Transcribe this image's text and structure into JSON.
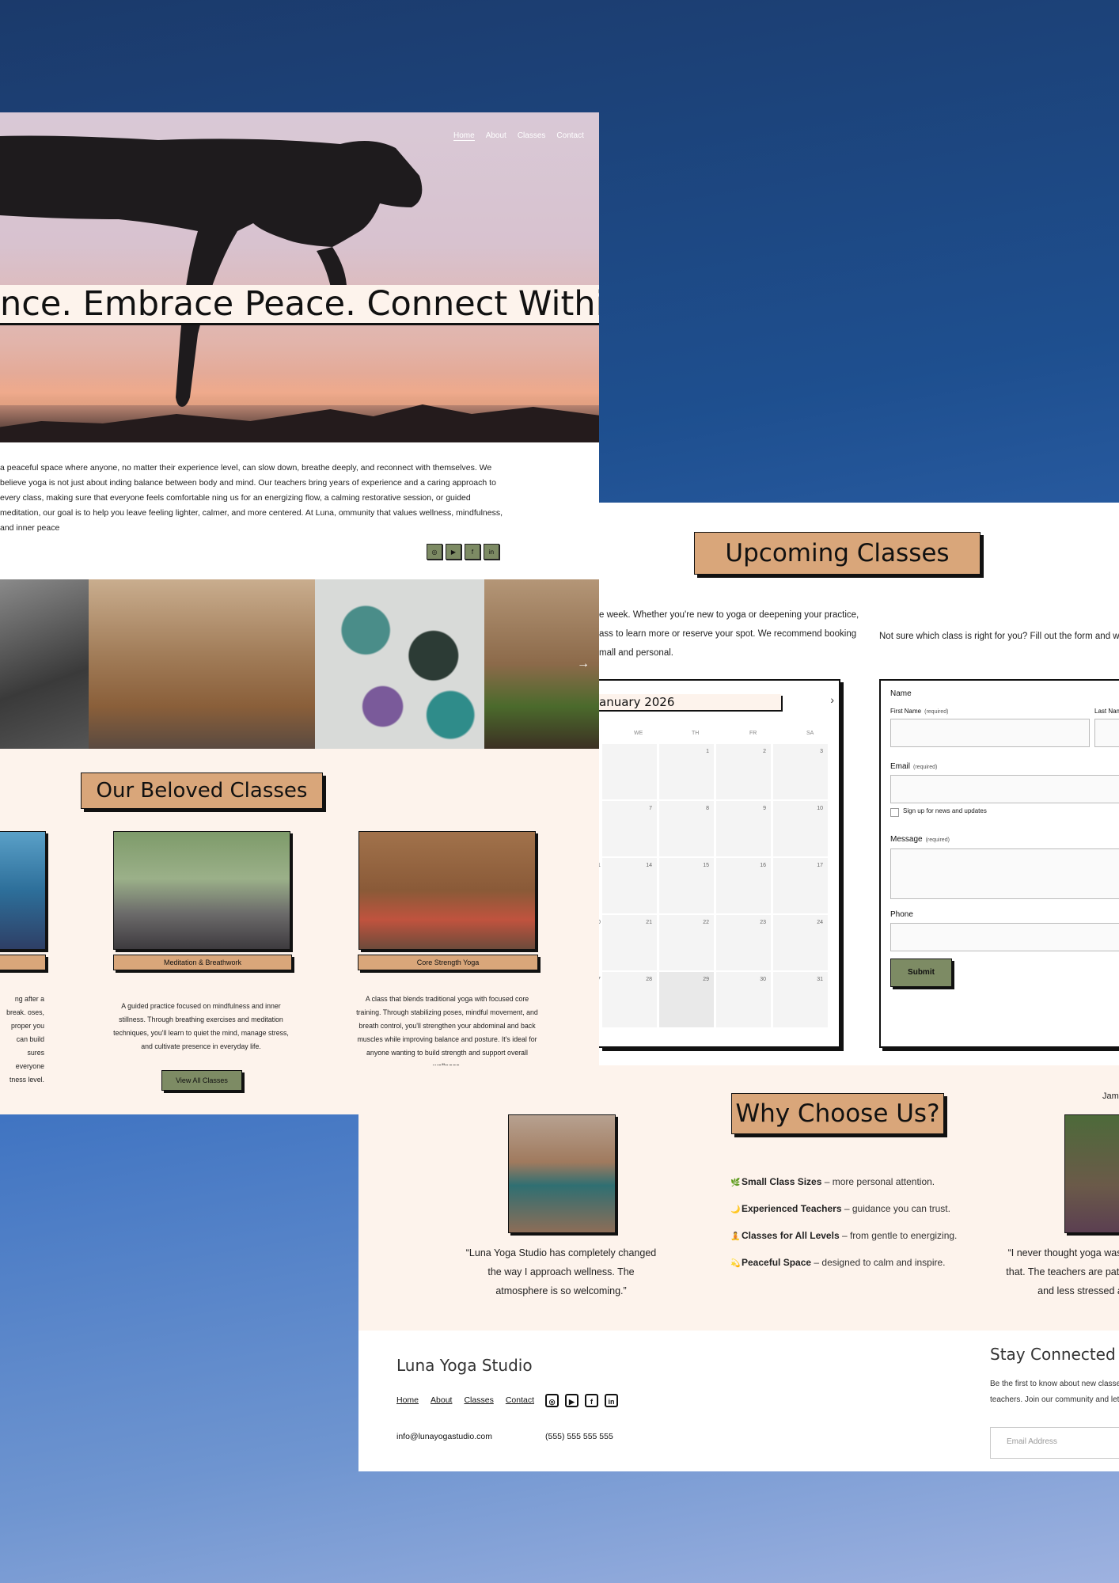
{
  "hero": {
    "nav": [
      "Home",
      "About",
      "Classes",
      "Contact"
    ],
    "title": "nce. Embrace Peace. Connect Within.",
    "intro": "a peaceful space where anyone, no matter their experience level, can slow down, breathe deeply, and reconnect with themselves. We believe yoga is not just about inding balance between body and mind. Our teachers bring years of experience and a caring approach to every class, making sure that everyone feels comfortable ning us for an energizing flow, a calming restorative session, or guided meditation, our goal is to help you leave feeling lighter, calmer, and more centered. At Luna, ommunity that values wellness, mindfulness, and inner peace",
    "social": [
      "instagram-icon",
      "youtube-icon",
      "facebook-icon",
      "linkedin-icon"
    ],
    "social_glyphs": [
      "◎",
      "▶",
      "f",
      "in"
    ],
    "gallery_arrow": "→"
  },
  "classes": {
    "title": "Our Beloved Classes",
    "items": [
      {
        "name": "",
        "desc": "ng after a break. oses, proper you can build sures everyone tness level."
      },
      {
        "name": "Meditation & Breathwork",
        "desc": "A guided practice focused on mindfulness and inner stillness. Through breathing exercises and meditation techniques, you'll learn to quiet the mind, manage stress, and cultivate presence in everyday life."
      },
      {
        "name": "Core Strength Yoga",
        "desc": "A class that blends traditional yoga with focused core training. Through stabilizing poses, mindful movement, and breath control, you'll strengthen your abdominal and back muscles while improving balance and posture. It's ideal for anyone wanting to build strength and support overall wellness."
      }
    ],
    "view_all": "View All Classes"
  },
  "upcoming": {
    "title": "Upcoming Classes",
    "text_lines": [
      "e week. Whether you're new to yoga or deepening your practice,",
      "ass to learn more or reserve your spot. We recommend booking",
      "mall and personal."
    ],
    "form_intro": "Not sure which class is right for you? Fill out the form and we'll h",
    "calendar": {
      "month": "anuary 2026",
      "next": "›",
      "weekdays": [
        "WE",
        "TH",
        "FR",
        "SA"
      ],
      "rows": [
        [
          "",
          "1",
          "2",
          "3"
        ],
        [
          "",
          "7",
          "8",
          "9",
          "10"
        ],
        [
          "",
          "14",
          "15",
          "16",
          "17"
        ],
        [
          "",
          "21",
          "22",
          "23",
          "24"
        ],
        [
          "",
          "28",
          "29",
          "30",
          "31"
        ]
      ],
      "row_left_stub": [
        "",
        "",
        "1",
        "0",
        "7"
      ]
    },
    "form": {
      "name_label": "Name",
      "first_name": "First Name",
      "last_name": "Last Name",
      "required": "(required)",
      "email_label": "Email",
      "signup": "Sign up for news and updates",
      "message_label": "Message",
      "phone_label": "Phone",
      "submit": "Submit"
    }
  },
  "why": {
    "title": "Why Choose Us?",
    "features": [
      {
        "icon": "🌿",
        "bold": "Small Class Sizes",
        "rest": " – more personal attention."
      },
      {
        "icon": "🌙",
        "bold": "Experienced Teachers",
        "rest": " – guidance you can trust."
      },
      {
        "icon": "🧘",
        "bold": "Classes for All Levels",
        "rest": " – from gentle to energizing."
      },
      {
        "icon": "💫",
        "bold": "Peaceful Space",
        "rest": " – designed to calm and inspire."
      }
    ],
    "testimonial1": "“Luna Yoga Studio has completely changed the way I approach wellness. The atmosphere is so welcoming.”",
    "testimonial2_lines": [
      "“I never thought yoga was for me",
      "that. The teachers are patient and",
      "and less stressed a"
    ],
    "testimonial2_name": "Jame"
  },
  "footer": {
    "brand": "Luna Yoga Studio",
    "nav": [
      "Home",
      "About",
      "Classes",
      "Contact"
    ],
    "icons": [
      "instagram-icon",
      "youtube-icon",
      "facebook-icon",
      "linkedin-icon"
    ],
    "icon_glyphs": [
      "◎",
      "▶",
      "f",
      "in"
    ],
    "email": "info@lunayogastudio.com",
    "phone": "(555) 555 555 555",
    "stay_title": "Stay Connected w",
    "stay_text_lines": [
      "Be the first to know about new classes,",
      "teachers. Join our community and let in"
    ],
    "email_placeholder": "Email Address"
  }
}
